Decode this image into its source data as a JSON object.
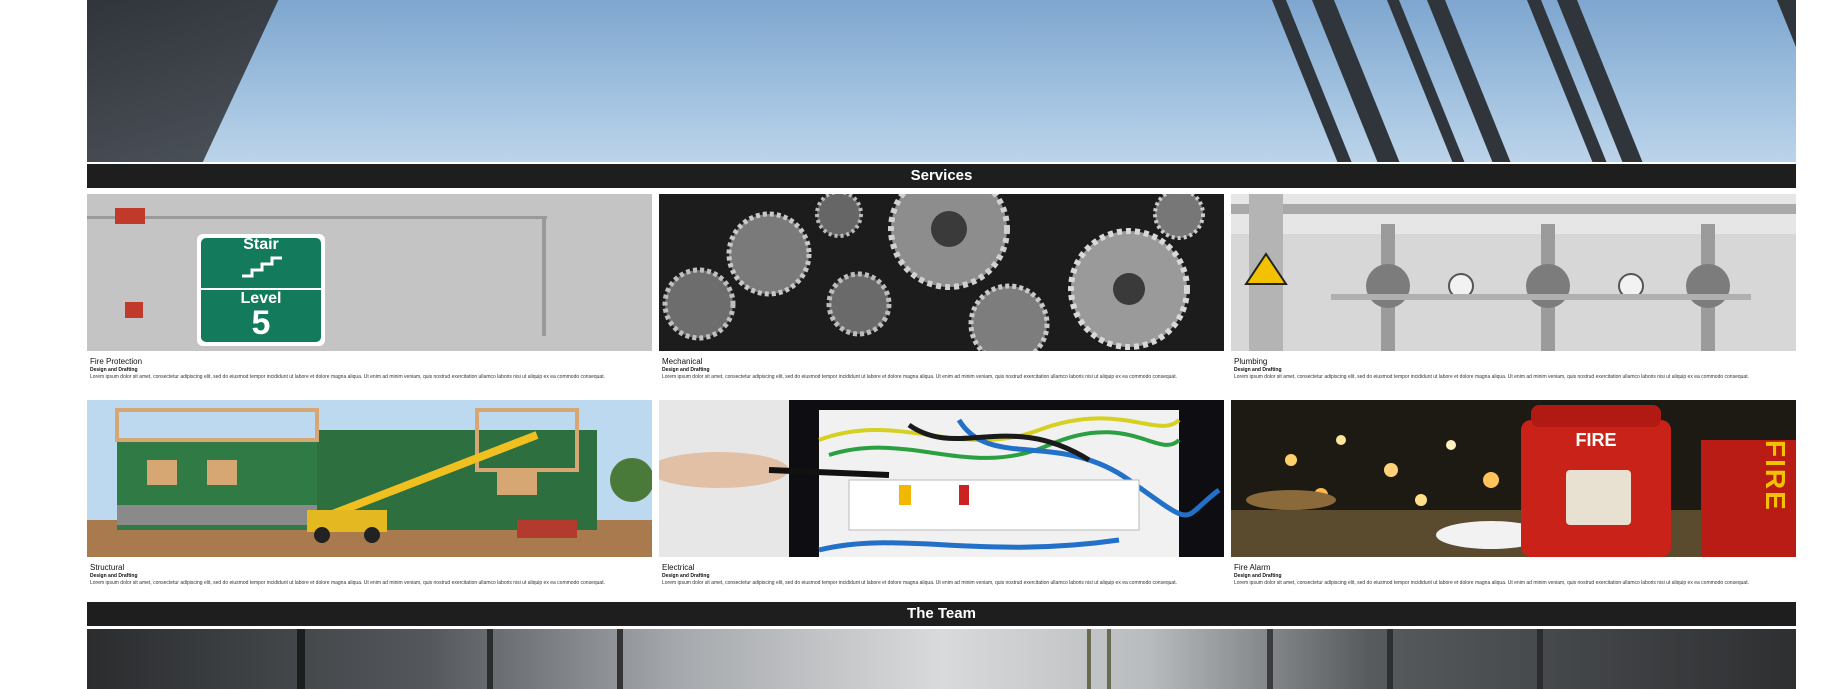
{
  "sections": {
    "services_heading": "Services",
    "team_heading": "The Team"
  },
  "services": [
    {
      "title": "Fire Protection",
      "subtitle": "Design and Drafting",
      "description": "Lorem ipsum dolor sit amet, consectetur adipiscing elit, sed do eiusmod tempor incididunt ut labore et dolore magna aliqua. Ut enim ad minim veniam, quis nostrud exercitation ullamco laboris nisi ut aliquip ex ea commodo consequat.",
      "image": "stair-level-sign"
    },
    {
      "title": "Mechanical",
      "subtitle": "Design and Drafting",
      "description": "Lorem ipsum dolor sit amet, consectetur adipiscing elit, sed do eiusmod tempor incididunt ut labore et dolore magna aliqua. Ut enim ad minim veniam, quis nostrud exercitation ullamco laboris nisi ut aliquip ex ea commodo consequat.",
      "image": "gears"
    },
    {
      "title": "Plumbing",
      "subtitle": "Design and Drafting",
      "description": "Lorem ipsum dolor sit amet, consectetur adipiscing elit, sed do eiusmod tempor incididunt ut labore et dolore magna aliqua. Ut enim ad minim veniam, quis nostrud exercitation ullamco laboris nisi ut aliquip ex ea commodo consequat.",
      "image": "pipes-valves"
    },
    {
      "title": "Structural",
      "subtitle": "Design and Drafting",
      "description": "Lorem ipsum dolor sit amet, consectetur adipiscing elit, sed do eiusmod tempor incididunt ut labore et dolore magna aliqua. Ut enim ad minim veniam, quis nostrud exercitation ullamco laboris nisi ut aliquip ex ea commodo consequat.",
      "image": "building-construction"
    },
    {
      "title": "Electrical",
      "subtitle": "Design and Drafting",
      "description": "Lorem ipsum dolor sit amet, consectetur adipiscing elit, sed do eiusmod tempor incididunt ut labore et dolore magna aliqua. Ut enim ad minim veniam, quis nostrud exercitation ullamco laboris nisi ut aliquip ex ea commodo consequat.",
      "image": "electrical-panel"
    },
    {
      "title": "Fire Alarm",
      "subtitle": "Design and Drafting",
      "description": "Lorem ipsum dolor sit amet, consectetur adipiscing elit, sed do eiusmod tempor incididunt ut labore et dolore magna aliqua. Ut enim ad minim veniam, quis nostrud exercitation ullamco laboris nisi ut aliquip ex ea commodo consequat.",
      "image": "fire-alarm-box"
    }
  ],
  "stair_sign": {
    "top": "Stair",
    "middle": "Level",
    "number": "5"
  },
  "fire_box_label": "FIRE",
  "fire_side_sign": "FIRE"
}
